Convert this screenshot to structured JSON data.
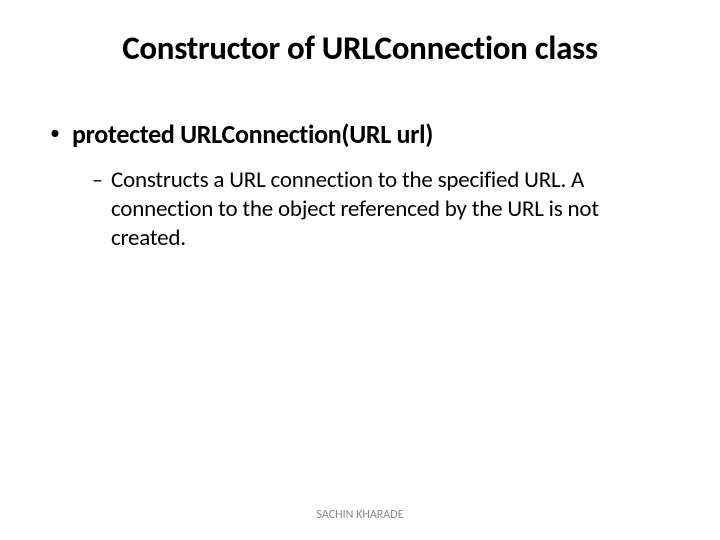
{
  "title": "Constructor of URLConnection class",
  "bullets": {
    "level1": {
      "mark": "•",
      "text": "protected URLConnection(URL url)"
    },
    "level2": {
      "mark": "–",
      "text": "Constructs a URL connection to the specified URL. A connection to the object referenced by the URL is not created."
    }
  },
  "footer": "SACHIN KHARADE"
}
